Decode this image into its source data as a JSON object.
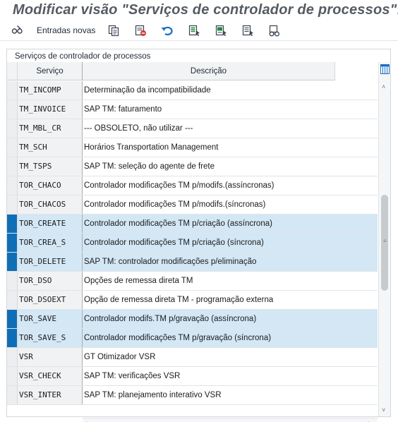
{
  "window": {
    "title": "Modificar visão \"Serviços de controlador de processos\": sín"
  },
  "toolbar": {
    "new_entries_label": "Entradas novas",
    "icons": [
      "display-change-icon",
      "copy-icon",
      "delete-icon",
      "undo-icon",
      "select-all-icon",
      "select-block-icon",
      "deselect-all-icon",
      "glasses-icon"
    ]
  },
  "panel": {
    "title": "Serviços de controlador de processos"
  },
  "table": {
    "columns": {
      "service": "Serviço",
      "description": "Descrição"
    },
    "rows": [
      {
        "service": "TM_INCOMP",
        "description": "Determinação da incompatibilidade",
        "selected": false
      },
      {
        "service": "TM_INVOICE",
        "description": "SAP TM: faturamento",
        "selected": false
      },
      {
        "service": "TM_MBL_CR",
        "description": "--- OBSOLETO, não utilizar ---",
        "selected": false
      },
      {
        "service": "TM_SCH",
        "description": "Horários Transportation Management",
        "selected": false
      },
      {
        "service": "TM_TSPS",
        "description": "SAP TM: seleção do agente de frete",
        "selected": false
      },
      {
        "service": "TOR_CHACO",
        "description": "Controlador modificações TM p/modifs.(assíncronas)",
        "selected": false
      },
      {
        "service": "TOR_CHACOS",
        "description": "Controlador modificações TM p/modifs.(síncronas)",
        "selected": false
      },
      {
        "service": "TOR_CREATE",
        "description": "Controlador modificações TM p/criação (assíncrona)",
        "selected": true
      },
      {
        "service": "TOR_CREA_S",
        "description": "Controlador modificações TM p/criação (síncrona)",
        "selected": true
      },
      {
        "service": "TOR_DELETE",
        "description": "SAP TM: controlador modificações p/eliminação",
        "selected": true
      },
      {
        "service": "TOR_DSO",
        "description": "Opções de remessa direta TM",
        "selected": false
      },
      {
        "service": "TOR_DSOEXT",
        "description": "Opção de remessa direta TM - programação externa",
        "selected": false
      },
      {
        "service": "TOR_SAVE",
        "description": "Controlador modifs.TM p/gravação (assíncrona)",
        "selected": true
      },
      {
        "service": "TOR_SAVE_S",
        "description": "Controlador modificações TM p/gravação (síncrona)",
        "selected": true
      },
      {
        "service": "VSR",
        "description": "GT Otimizador VSR",
        "selected": false
      },
      {
        "service": "VSR_CHECK",
        "description": "SAP TM: verificações VSR",
        "selected": false
      },
      {
        "service": "VSR_INTER",
        "description": "SAP TM: planejamento interativo VSR",
        "selected": false
      }
    ]
  },
  "colors": {
    "selection_marker": "#0f6fb6",
    "selection_row": "#d3e7f5",
    "title_text": "#555b62"
  }
}
